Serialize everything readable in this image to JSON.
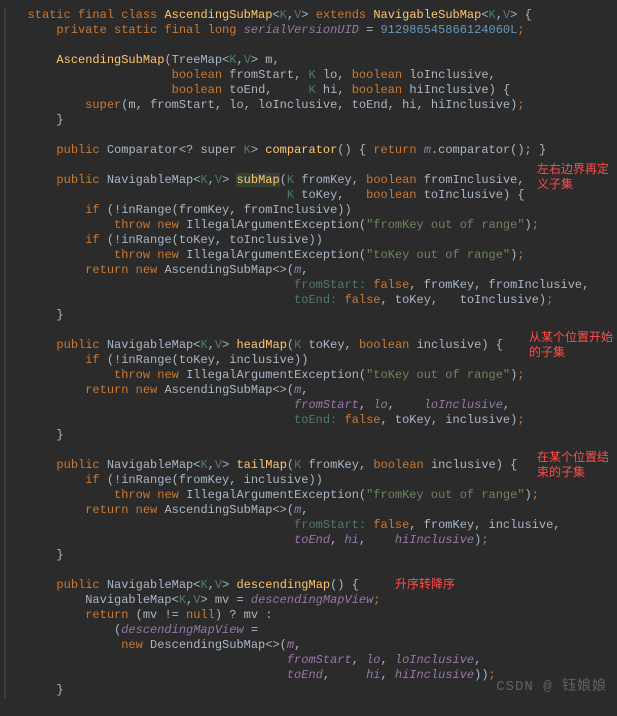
{
  "class_decl": {
    "modifiers": "static final class",
    "name": "AscendingSubMap",
    "generics_K": "K",
    "generics_V": "V",
    "extends": "extends",
    "parent": "NavigableSubMap",
    "brace": "{"
  },
  "serial": {
    "modifiers": "private static final long",
    "name": "serialVersionUID",
    "equals": "=",
    "value": "912986545866124060L",
    "semi": ";"
  },
  "ctor": {
    "name": "AscendingSubMap",
    "treemap": "TreeMap",
    "param_m": "m",
    "boolean": "boolean",
    "fromStart": "fromStart",
    "lo": "lo",
    "loInclusive": "loInclusive",
    "toEnd": "toEnd",
    "hi": "hi",
    "hiInclusive": "hiInclusive",
    "super": "super",
    "close": "}"
  },
  "comparator": {
    "public": "public",
    "ret": "Comparator",
    "q": "<? super",
    "name": "comparator",
    "return": "return",
    "m": "m",
    "call": ".comparator();",
    "close": "}"
  },
  "subMap": {
    "public": "public",
    "ret": "NavigableMap",
    "name": "subMap",
    "fromKey": "fromKey",
    "boolean": "boolean",
    "fromInclusive": "fromInclusive",
    "toKey": "toKey",
    "toInclusive": "toInclusive",
    "if": "if",
    "inRange": "!inRange",
    "throw": "throw",
    "new": "new",
    "exc": "IllegalArgumentException",
    "err1": "\"fromKey out of range\"",
    "err2": "\"toKey out of range\"",
    "return": "return",
    "cls": "AscendingSubMap",
    "fromStart_lbl": "fromStart:",
    "toEnd_lbl": "toEnd:",
    "false": "false",
    "m": "m",
    "close": "}"
  },
  "headMap": {
    "public": "public",
    "ret": "NavigableMap",
    "name": "headMap",
    "toKey": "toKey",
    "boolean": "boolean",
    "inclusive": "inclusive",
    "if": "if",
    "inRange": "!inRange",
    "throw": "throw",
    "new": "new",
    "exc": "IllegalArgumentException",
    "err": "\"toKey out of range\"",
    "return": "return",
    "cls": "AscendingSubMap",
    "fromStart": "fromStart",
    "lo": "lo",
    "loInclusive": "loInclusive",
    "toEnd_lbl": "toEnd:",
    "false": "false",
    "m": "m",
    "close": "}"
  },
  "tailMap": {
    "public": "public",
    "ret": "NavigableMap",
    "name": "tailMap",
    "fromKey": "fromKey",
    "boolean": "boolean",
    "inclusive": "inclusive",
    "if": "if",
    "inRange": "!inRange",
    "throw": "throw",
    "new": "new",
    "exc": "IllegalArgumentException",
    "err": "\"fromKey out of range\"",
    "return": "return",
    "cls": "AscendingSubMap",
    "fromStart_lbl": "fromStart:",
    "false": "false",
    "toEnd": "toEnd",
    "hi": "hi",
    "hiInclusive": "hiInclusive",
    "m": "m",
    "close": "}"
  },
  "descMap": {
    "public": "public",
    "ret": "NavigableMap",
    "name": "descendingMap",
    "mv": "mv",
    "eq": "=",
    "view": "descendingMapView",
    "return": "return",
    "null": "null",
    "q": "?",
    "colon": ":",
    "new": "new",
    "cls": "DescendingSubMap",
    "fromStart": "fromStart",
    "lo": "lo",
    "loInclusive": "loInclusive",
    "toEnd": "toEnd",
    "hi": "hi",
    "hiInclusive": "hiInclusive",
    "m": "m",
    "close": "}"
  },
  "annotations": {
    "a1_l1": "左右边界再定",
    "a1_l2": "义子集",
    "a2_l1": "从某个位置开始",
    "a2_l2": "的子集",
    "a3_l1": "在某个位置结",
    "a3_l2": "束的子集",
    "a4": "升序转降序"
  },
  "watermark": "CSDN @ 钰娘娘"
}
